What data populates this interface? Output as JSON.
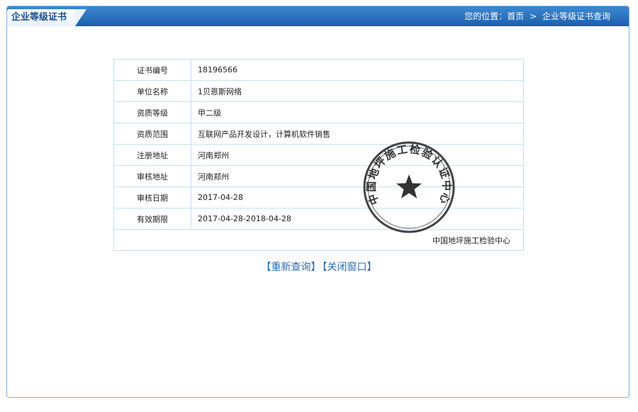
{
  "header": {
    "title": "企业等级证书",
    "breadcrumb_prefix": "您的位置：",
    "breadcrumb_home": "首页",
    "breadcrumb_sep": ">",
    "breadcrumb_current": "企业等级证书查询"
  },
  "certificate": {
    "rows": [
      {
        "label": "证书编号",
        "value": "18196566"
      },
      {
        "label": "单位名称",
        "value": "1贝恩斯网络"
      },
      {
        "label": "资质等级",
        "value": "甲二级"
      },
      {
        "label": "资质范围",
        "value": "互联网产品开发设计，计算机软件销售"
      },
      {
        "label": "注册地址",
        "value": "河南郑州"
      },
      {
        "label": "审核地址",
        "value": "河南郑州"
      },
      {
        "label": "审核日期",
        "value": "2017-04-28"
      },
      {
        "label": "有效期限",
        "value": "2017-04-28-2018-04-28"
      }
    ],
    "issuer": "中国地坪施工检验中心"
  },
  "seal": {
    "text": "中国地坪施工检验认证中心",
    "color": "#333333"
  },
  "actions": {
    "requery": "【重新查询】",
    "close": "【关闭窗口】"
  },
  "colors": {
    "header_blue": "#1b5fae",
    "border_blue": "#c7e0f3",
    "link_blue": "#2a6db3"
  }
}
